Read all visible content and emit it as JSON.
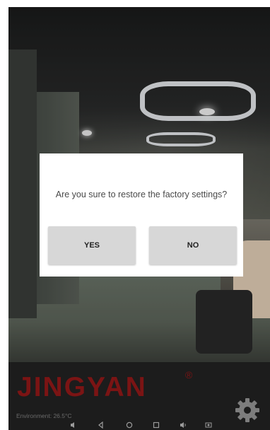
{
  "dialog": {
    "message": "Are you sure to restore the factory settings?",
    "yes_label": "YES",
    "no_label": "NO"
  },
  "branding": {
    "logo_text": "JINGYAN",
    "registered_mark": "®"
  },
  "status": {
    "environment": "Environment: 26.5°C"
  },
  "icons": {
    "settings": "gear-icon",
    "volume_down": "volume-down-icon",
    "back": "back-icon",
    "home": "home-icon",
    "recents": "recents-icon",
    "volume_up": "volume-up-icon",
    "screenshot": "screenshot-icon"
  },
  "colors": {
    "brand": "#7b1414",
    "button_bg": "#d7d7d7",
    "dialog_bg": "#ffffff"
  }
}
